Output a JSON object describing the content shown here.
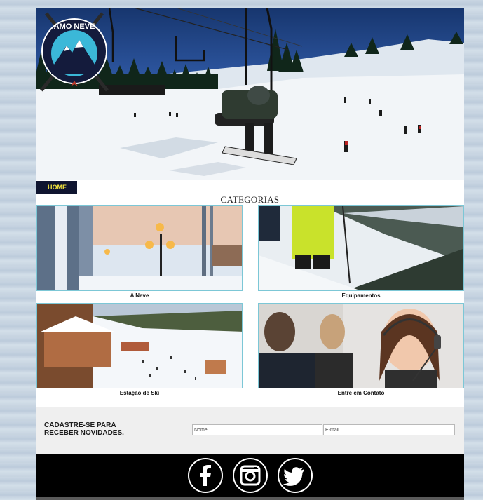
{
  "logo": {
    "text": "AMO NEVE"
  },
  "nav": {
    "home_label": "HOME"
  },
  "categories_title": "CATEGORIAS",
  "categories": [
    {
      "caption": "A Neve"
    },
    {
      "caption": "Equipamentos"
    },
    {
      "caption": "Estação de Ski"
    },
    {
      "caption": "Entre em Contato"
    }
  ],
  "newsletter": {
    "line1": "CADASTRE-SE PARA",
    "line2": "RECEBER NOVIDADES.",
    "name_placeholder": "Nome",
    "email_placeholder": "E-mail"
  },
  "social": [
    {
      "icon": "facebook-icon"
    },
    {
      "icon": "instagram-icon"
    },
    {
      "icon": "twitter-icon"
    }
  ],
  "colors": {
    "nav_bg": "#0f1530",
    "nav_text": "#f4e53d",
    "card_border": "#7cc7d6",
    "footer_bg": "#000000"
  }
}
